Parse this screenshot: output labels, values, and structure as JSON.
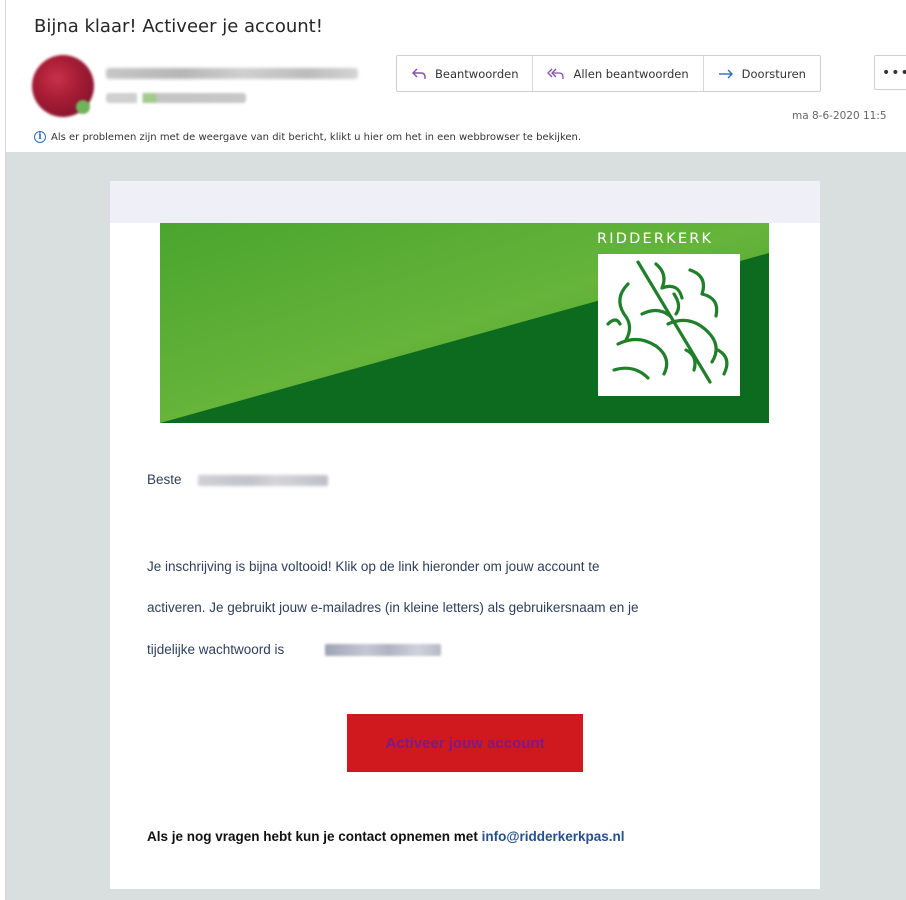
{
  "email": {
    "subject": "Bijna klaar! Activeer je account!",
    "date": "ma 8-6-2020 11:5",
    "info_message": "Als er problemen zijn met de weergave van dit bericht, klikt u hier om het in een webbrowser te bekijken."
  },
  "toolbar": {
    "reply_label": "Beantwoorden",
    "reply_all_label": "Allen beantwoorden",
    "forward_label": "Doorsturen",
    "more_label": "•••"
  },
  "message": {
    "brand_name": "RIDDERKERK",
    "greeting": "Beste",
    "body_line1": "Je inschrijving is bijna voltooid! Klik op de link hieronder om jouw account te",
    "body_line2": "activeren. Je gebruikt jouw e-mailadres (in kleine letters) als gebruikersnaam en je",
    "body_line3": "tijdelijke wachtwoord is",
    "cta_label": "Activeer jouw account",
    "contact_text": "Als je nog vragen hebt kun je contact opnemen met",
    "contact_email": "info@ridderkerkpas.nl"
  },
  "colors": {
    "banner_light_green": "#5aae32",
    "banner_dark_green": "#0d6b1f",
    "cta_red": "#d0181f",
    "cta_text": "#7e1a86",
    "link_blue": "#264f8f"
  },
  "icons": {
    "reply": "reply-arrow-icon",
    "reply_all": "reply-all-arrow-icon",
    "forward": "forward-arrow-icon",
    "info": "info-icon",
    "crest": "knight-on-horse-logo"
  }
}
